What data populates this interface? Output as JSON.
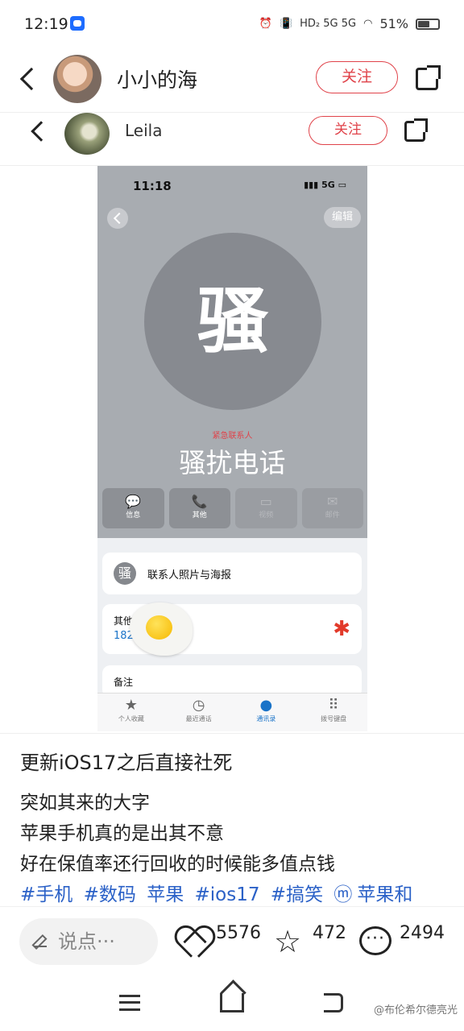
{
  "status_bar": {
    "time": "12:19",
    "network_icons": "HD₂ 5G 5G",
    "battery": "51%"
  },
  "top_nav": {
    "username": "小小的海",
    "follow_label": "关注"
  },
  "embedded_nav": {
    "username": "Leila",
    "follow_label": "关注"
  },
  "phone_screenshot": {
    "time": "11:18",
    "signal": "5G",
    "edit_label": "编辑",
    "avatar_char": "骚",
    "emergency_label": "紧急联系人",
    "contact_name": "骚扰电话",
    "actions": [
      {
        "icon": "message-icon",
        "label": "信息"
      },
      {
        "icon": "phone-icon",
        "label": "其他"
      },
      {
        "icon": "video-icon",
        "label": "视频"
      },
      {
        "icon": "mail-icon",
        "label": "邮件"
      }
    ],
    "card_photo_label": "联系人照片与海报",
    "card_other_label": "其他",
    "card_other_number": "182",
    "card_notes_label": "备注",
    "tabs": [
      {
        "icon": "star-icon",
        "label": "个人收藏"
      },
      {
        "icon": "clock-icon",
        "label": "最近通话"
      },
      {
        "icon": "contacts-icon",
        "label": "通讯录"
      },
      {
        "icon": "keypad-icon",
        "label": "拨号键盘"
      }
    ]
  },
  "post": {
    "title": "更新iOS17之后直接社死",
    "lines": [
      "突如其来的大字",
      "苹果手机真的是出其不意",
      "好在保值率还行回收的时候能多值点钱"
    ],
    "tags": [
      "#手机",
      "#数码",
      "苹果",
      "#ios17",
      "#搞笑",
      "苹果和"
    ]
  },
  "action_bar": {
    "comment_placeholder": "说点···",
    "likes": "5576",
    "stars": "472",
    "comments": "2494"
  },
  "watermark": "@布伦希尔德亮光",
  "colors": {
    "follow": "#e0434a",
    "tag": "#2b61c7",
    "phone_bg": "#a8acb1"
  }
}
